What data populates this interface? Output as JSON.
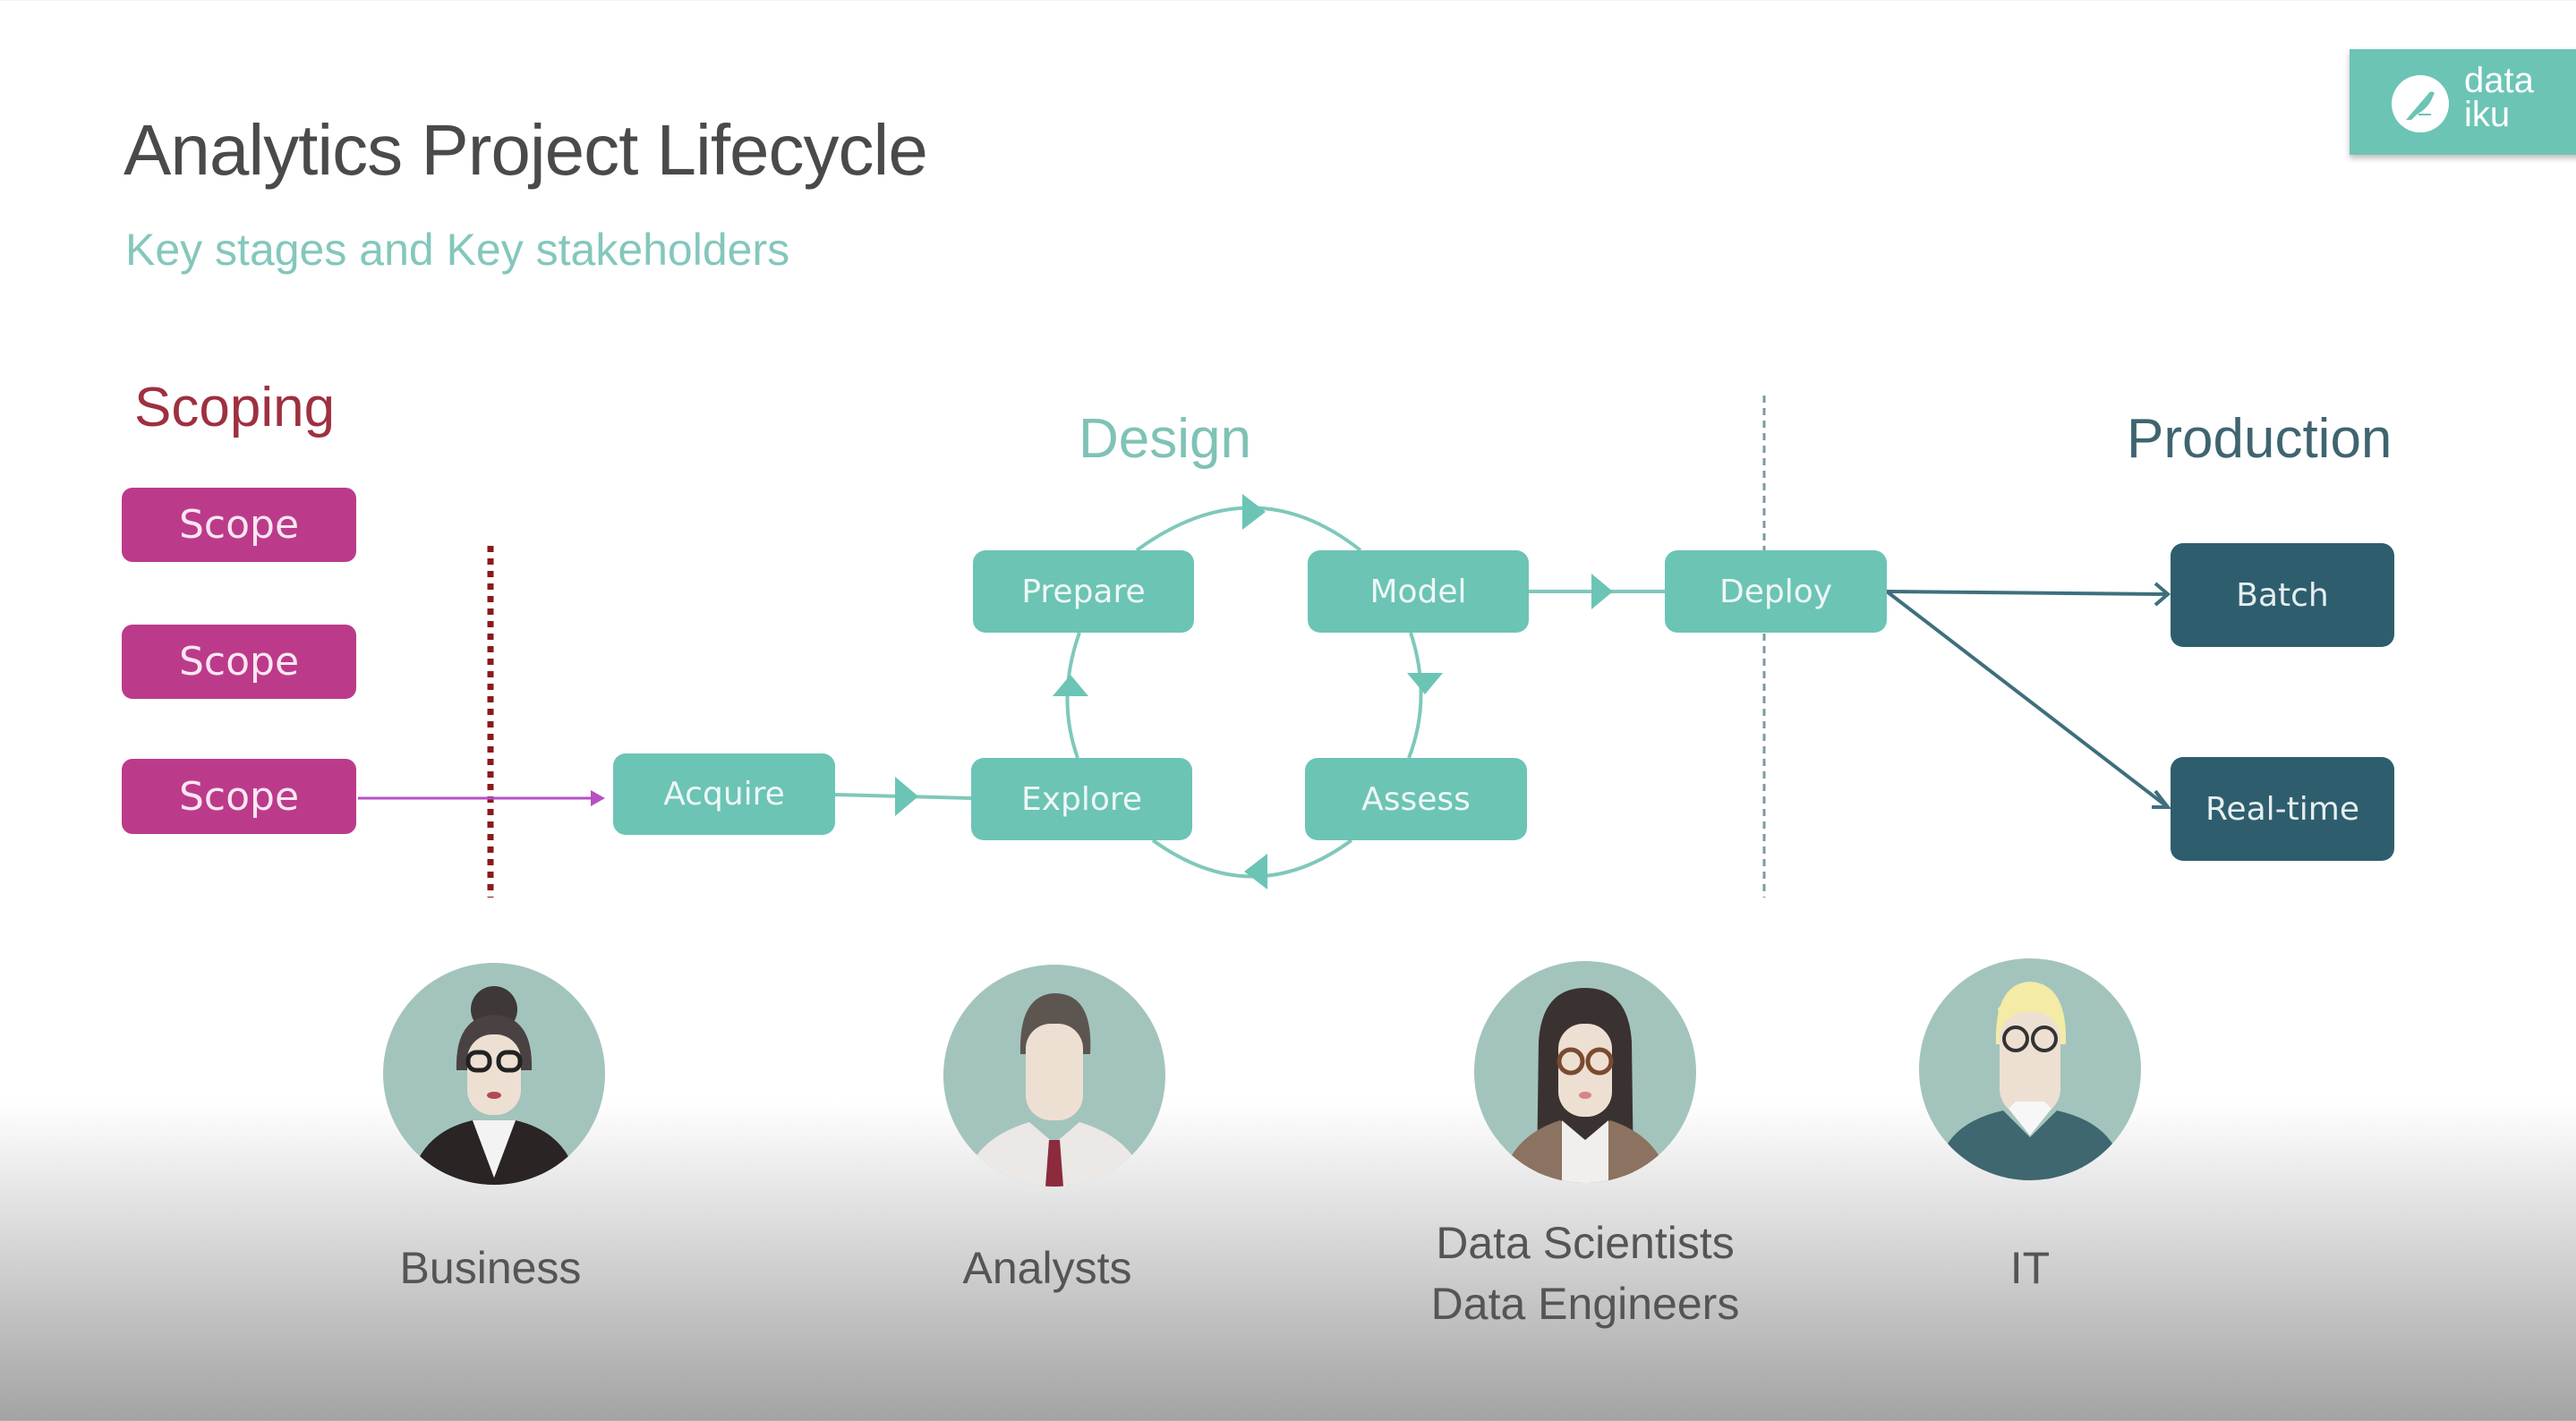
{
  "header": {
    "title": "Analytics Project Lifecycle",
    "subtitle": "Key stages and Key stakeholders"
  },
  "logo": {
    "icon": "bird-icon",
    "line1": "data",
    "line2": "iku",
    "color": "#6cc4b5"
  },
  "phases": {
    "scoping": "Scoping",
    "design": "Design",
    "production": "Production"
  },
  "scoping": {
    "boxes": [
      "Scope",
      "Scope",
      "Scope"
    ],
    "color": "#bb3b8a"
  },
  "design": {
    "acquire": "Acquire",
    "explore": "Explore",
    "prepare": "Prepare",
    "model": "Model",
    "assess": "Assess",
    "deploy": "Deploy",
    "color": "#6cc4b5"
  },
  "production": {
    "batch": "Batch",
    "realtime": "Real-time",
    "color": "#2e5e6d"
  },
  "stakeholders": [
    {
      "label": "Business",
      "icon": "businesswoman-avatar"
    },
    {
      "label": "Analysts",
      "icon": "analyst-avatar"
    },
    {
      "label_line1": "Data Scientists",
      "label_line2": "Data Engineers",
      "icon": "data-scientist-avatar"
    },
    {
      "label": "IT",
      "icon": "it-avatar"
    }
  ]
}
